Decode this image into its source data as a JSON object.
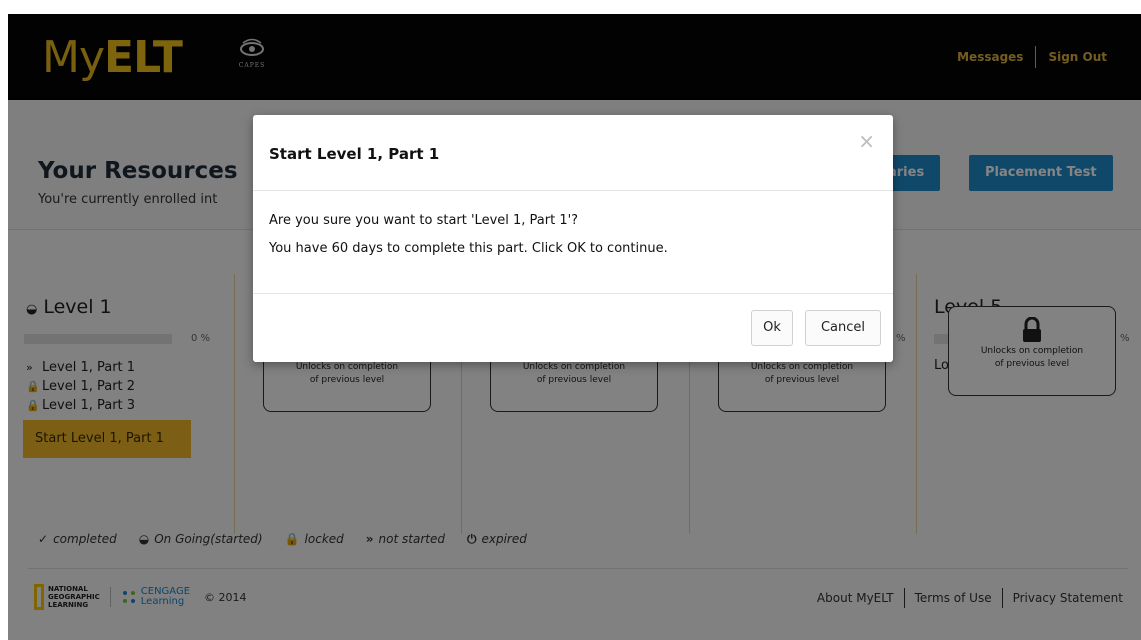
{
  "header": {
    "logo": {
      "my": "My",
      "elt": "ELT"
    },
    "partner_logo_text": "CAPES",
    "nav": {
      "messages": "Messages",
      "sign_out": "Sign Out"
    }
  },
  "resources": {
    "title": "Your Resources",
    "subtitle": "You're currently enrolled int",
    "buttons": {
      "summaries_partial": "aries",
      "placement_test": "Placement Test"
    }
  },
  "levels": {
    "level1": {
      "title": "Level 1",
      "percent": "0 %",
      "progress": 0,
      "parts": [
        {
          "icon": "»",
          "label": "Level 1, Part 1"
        },
        {
          "icon": "🔒",
          "label": "Level 1, Part 2"
        },
        {
          "icon": "🔒",
          "label": "Level 1, Part 3"
        }
      ],
      "start_button": "Start  Level 1, Part 1"
    },
    "level5": {
      "title": "Level 5",
      "percent": "%",
      "partial_text": "Lo"
    },
    "lock_text": {
      "line1": "Unlocks on completion",
      "line2": "of previous level"
    },
    "partial_percent_col4": "%"
  },
  "legend": [
    {
      "icon": "✓",
      "label": "completed"
    },
    {
      "icon": "◒",
      "label": "On Going(started)"
    },
    {
      "icon": "🔒",
      "label": "locked"
    },
    {
      "icon": "»",
      "label": "not started"
    },
    {
      "icon": "⏻",
      "label": "expired"
    }
  ],
  "footer": {
    "ng_logo": {
      "line1": "NATIONAL",
      "line2": "GEOGRAPHIC",
      "line3": "LEARNING"
    },
    "cengage_logo": {
      "line1": "CENGAGE",
      "line2": "Learning"
    },
    "copyright": "© 2014",
    "links": {
      "about": "About MyELT",
      "terms": "Terms of Use",
      "privacy": "Privacy Statement"
    }
  },
  "modal": {
    "title": "Start  Level 1, Part 1",
    "close": "×",
    "message1": "Are you sure you want to start 'Level 1, Part 1'?",
    "message2": "You have 60 days to complete this part. Click OK to continue.",
    "ok_label": "Ok",
    "cancel_label": "Cancel"
  },
  "colors": {
    "brand_gold": "#f0b429",
    "header_bg": "#050505",
    "primary_blue": "#1f8ac9"
  }
}
